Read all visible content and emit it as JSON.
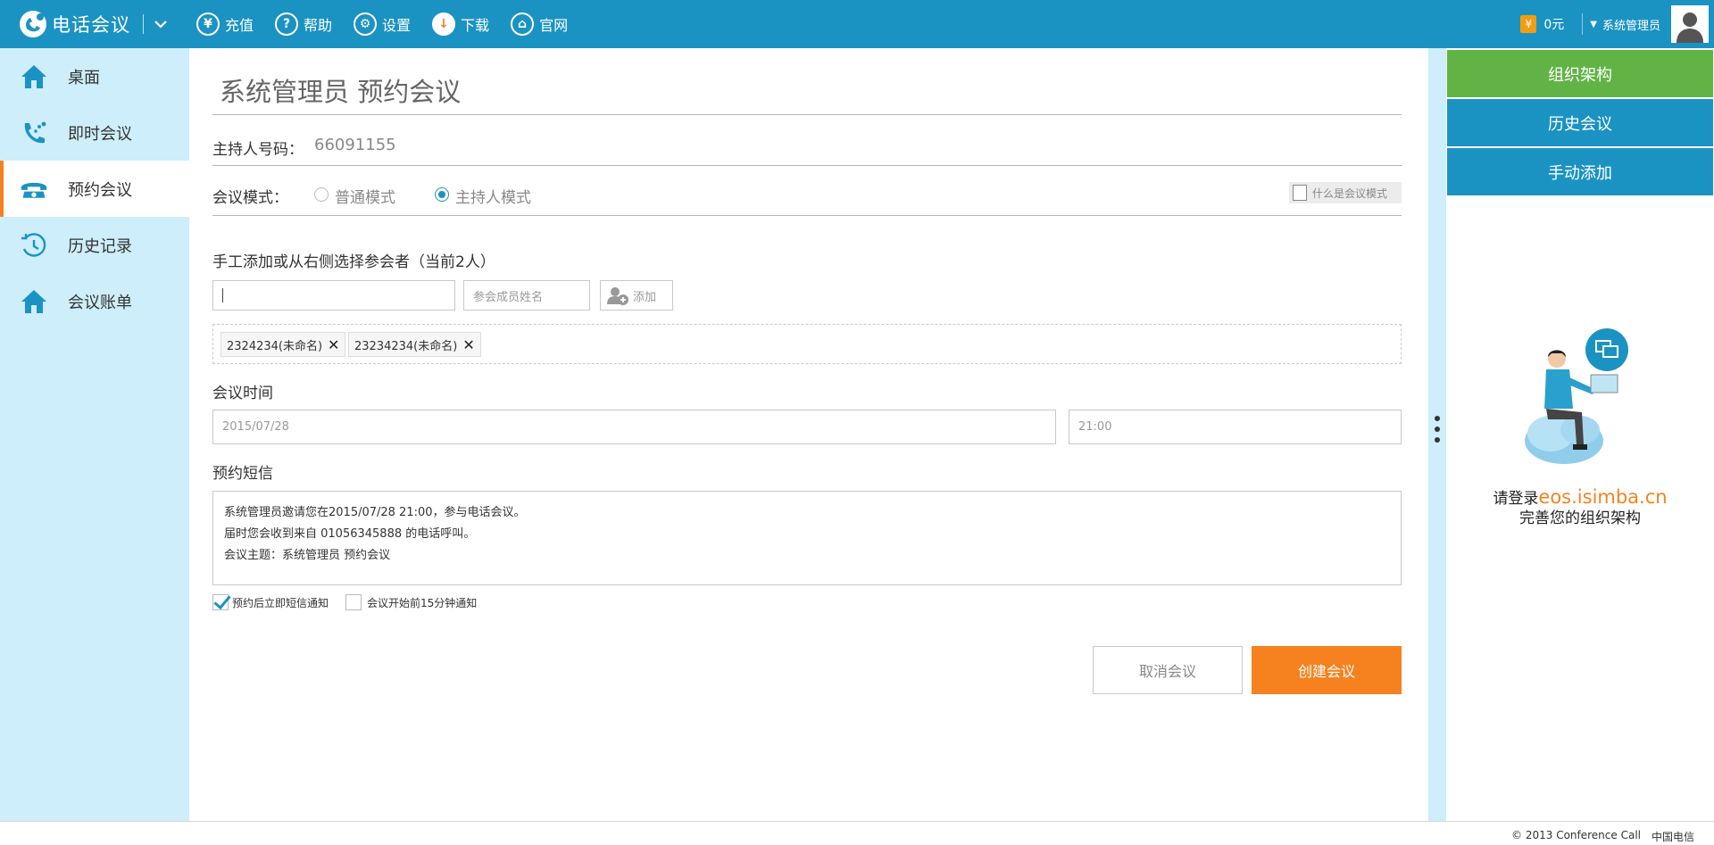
{
  "header": {
    "app_name": "电话会议",
    "nav": [
      {
        "label": "充值",
        "icon": "yen-icon",
        "glyph": "¥"
      },
      {
        "label": "帮助",
        "icon": "help-icon",
        "glyph": "?"
      },
      {
        "label": "设置",
        "icon": "gear-icon",
        "glyph": "⚙"
      },
      {
        "label": "下载",
        "icon": "download-icon",
        "glyph": "↓"
      },
      {
        "label": "官网",
        "icon": "home-icon",
        "glyph": "⌂"
      }
    ],
    "coin_glyph": "¥",
    "balance": "0元",
    "username": "系统管理员"
  },
  "sidebar": {
    "items": [
      {
        "label": "桌面",
        "icon": "home-icon"
      },
      {
        "label": "即时会议",
        "icon": "phone-icon"
      },
      {
        "label": "预约会议",
        "icon": "telephone-icon"
      },
      {
        "label": "历史记录",
        "icon": "history-icon"
      },
      {
        "label": "会议账单",
        "icon": "home-icon"
      }
    ],
    "active_index": 2
  },
  "main": {
    "title": "系统管理员 预约会议",
    "host_label": "主持人号码：",
    "host_number": "66091155",
    "mode_label": "会议模式：",
    "mode_options": [
      "普通模式",
      "主持人模式"
    ],
    "mode_selected": "主持人模式",
    "mode_help": "什么是会议模式",
    "participants_label": "手工添加或从右侧选择参会者（当前2人）",
    "phone_input_value": "",
    "name_input_placeholder": "参会成员姓名",
    "add_button": "添加",
    "participants": [
      "2324234(未命名)",
      "23234234(未命名)"
    ],
    "time_label": "会议时间",
    "date_value": "2015/07/28",
    "time_value": "21:00",
    "sms_label": "预约短信",
    "sms_lines": [
      "系统管理员邀请您在2015/07/28 21:00，参与电话会议。",
      "届时您会收到来自 01056345888 的电话呼叫。",
      "会议主题：系统管理员 预约会议"
    ],
    "notify_options": [
      {
        "label": "预约后立即短信通知",
        "checked": true
      },
      {
        "label": "会议开始前15分钟通知",
        "checked": false
      }
    ],
    "cancel_button": "取消会议",
    "create_button": "创建会议"
  },
  "right_panel": {
    "buttons": [
      {
        "label": "组织架构",
        "color": "#62b346"
      },
      {
        "label": "历史会议",
        "color": "#1b93c2"
      },
      {
        "label": "手动添加",
        "color": "#1b93c2"
      }
    ],
    "message_prefix": "请登录",
    "message_link": "eos.isimba.cn",
    "message_line2": "完善您的组织架构"
  },
  "footer": {
    "copyright": "© 2013 Conference Call",
    "org": "中国电信"
  },
  "colors": {
    "primary": "#1b93c2",
    "accent": "#f5821f",
    "sidebar_bg": "#cdeefa",
    "green": "#62b346"
  }
}
